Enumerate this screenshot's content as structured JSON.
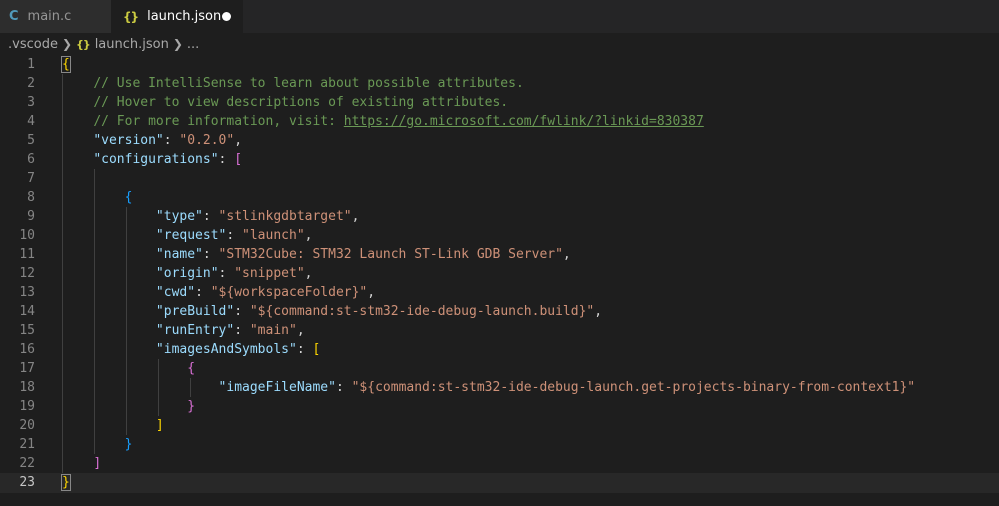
{
  "tabs": [
    {
      "icon": "C",
      "label": "main.c"
    },
    {
      "icon": "{}",
      "label": "launch.json",
      "modified": true
    }
  ],
  "breadcrumb": {
    "folder": ".vscode",
    "file_icon": "{}",
    "file": "launch.json",
    "more": "..."
  },
  "editor": {
    "line_numbers": [
      "1",
      "2",
      "3",
      "4",
      "5",
      "6",
      "7",
      "8",
      "9",
      "10",
      "11",
      "12",
      "13",
      "14",
      "15",
      "16",
      "17",
      "18",
      "19",
      "20",
      "21",
      "22",
      "23"
    ],
    "active_line": 23,
    "code": {
      "open_brace": "{",
      "comment1": "// Use IntelliSense to learn about possible attributes.",
      "comment2": "// Hover to view descriptions of existing attributes.",
      "comment3": "// For more information, visit: ",
      "comment3_link": "https://go.microsoft.com/fwlink/?linkid=830387",
      "version_key": "\"version\"",
      "version_val": "\"0.2.0\"",
      "configurations_key": "\"configurations\"",
      "type_key": "\"type\"",
      "type_val": "\"stlinkgdbtarget\"",
      "request_key": "\"request\"",
      "request_val": "\"launch\"",
      "name_key": "\"name\"",
      "name_val": "\"STM32Cube: STM32 Launch ST-Link GDB Server\"",
      "origin_key": "\"origin\"",
      "origin_val": "\"snippet\"",
      "cwd_key": "\"cwd\"",
      "cwd_val": "\"${workspaceFolder}\"",
      "prebuild_key": "\"preBuild\"",
      "prebuild_val": "\"${command:st-stm32-ide-debug-launch.build}\"",
      "runentry_key": "\"runEntry\"",
      "runentry_val": "\"main\"",
      "images_key": "\"imagesAndSymbols\"",
      "imagefile_key": "\"imageFileName\"",
      "imagefile_val": "\"${command:st-stm32-ide-debug-launch.get-projects-binary-from-context1}\"",
      "close_brace": "}"
    }
  },
  "colors": {
    "background": "#1e1e1e",
    "key": "#9cdcfe",
    "string": "#ce9178",
    "comment": "#6a9955",
    "bracket_level1": "#ffd700",
    "bracket_level2": "#da70d6",
    "bracket_level3": "#179fff"
  }
}
